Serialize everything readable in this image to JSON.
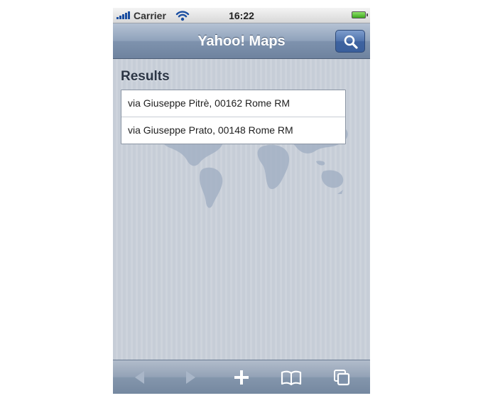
{
  "status_bar": {
    "carrier": "Carrier",
    "time": "16:22",
    "icons": [
      "signal-icon",
      "wifi-icon",
      "battery-icon"
    ]
  },
  "nav_bar": {
    "title": "Yahoo! Maps",
    "search_icon": "search-icon"
  },
  "results": {
    "heading": "Results",
    "items": [
      {
        "address": "via Giuseppe Pitrè, 00162 Rome RM"
      },
      {
        "address": "via Giuseppe Prato, 00148 Rome RM"
      }
    ]
  },
  "toolbar": {
    "icons": [
      "back-arrow-icon",
      "forward-arrow-icon",
      "add-icon",
      "bookmarks-icon",
      "pages-icon"
    ]
  },
  "colors": {
    "nav_bar": "#8fa2bb",
    "search_button": "#4f73ad",
    "background_stripes": "#c6cdd7",
    "battery": "#3da81e",
    "signal": "#1a4ea1"
  }
}
